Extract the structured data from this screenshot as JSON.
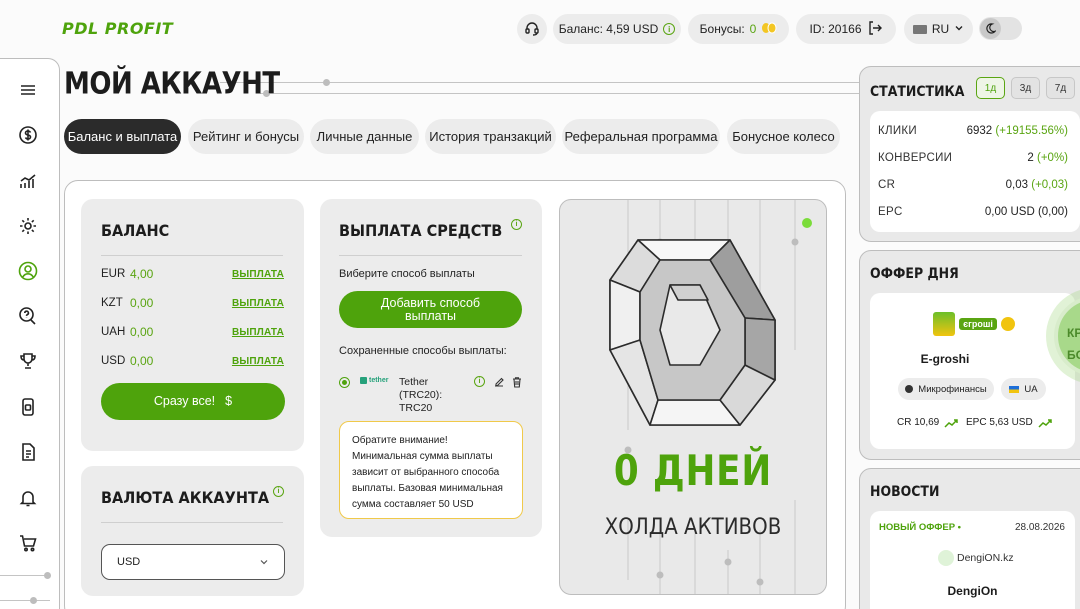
{
  "app": {
    "logo": "PDL PROFIT",
    "balance_label": "Баланс: 4,59 USD",
    "bonus_label": "Бонусы:",
    "bonus_value": "0",
    "id_label": "ID: 20166",
    "lang": "RU",
    "colors": {
      "accent": "#4ea30c",
      "dark": "#2b2b2b",
      "card": "#ececec",
      "notice_border": "#f0c94a"
    }
  },
  "page": {
    "title": "МОЙ АККАУНТ"
  },
  "tabs": [
    {
      "label": "Баланс и выплата",
      "active": true
    },
    {
      "label": "Рейтинг и бонусы"
    },
    {
      "label": "Личные данные"
    },
    {
      "label": "История транзакций"
    },
    {
      "label": "Реферальная программа"
    },
    {
      "label": "Бонусное колесо"
    }
  ],
  "balance": {
    "title": "БАЛАНС",
    "rows": [
      {
        "currency": "EUR",
        "amount": "4,00",
        "link": "ВЫПЛАТА"
      },
      {
        "currency": "KZT",
        "amount": "0,00",
        "link": "ВЫПЛАТА"
      },
      {
        "currency": "UAH",
        "amount": "0,00",
        "link": "ВЫПЛАТА"
      },
      {
        "currency": "USD",
        "amount": "0,00",
        "link": "ВЫПЛАТА"
      }
    ],
    "all_button": "Сразу все!",
    "all_button_icon": "$"
  },
  "currency": {
    "title": "ВАЛЮТА АККАУНТА",
    "selected": "USD"
  },
  "payout": {
    "title": "ВЫПЛАТА СРЕДСТВ",
    "choose_label": "Виберите способ выплаты",
    "add_button": "Добавить способ выплаты",
    "saved_label": "Сохраненные способы выплаты:",
    "method_logo": "tether",
    "method_name": "Tether (TRC20): TRC20",
    "notice": "Обратите внимание! Минимальная сумма выплаты зависит от выбранного способа выплаты. Базовая минимальная сумма составляет 50 USD"
  },
  "promo": {
    "big": "0 ДНЕЙ",
    "sub": "ХОЛДА АКТИВОВ",
    "glyph": "0"
  },
  "stats": {
    "title": "СТАТИСТИКА",
    "periods": [
      "1д",
      "3д",
      "7д"
    ],
    "rows": [
      {
        "label": "КЛИКИ",
        "value": "6932",
        "delta": "(+19155.56%)"
      },
      {
        "label": "КОНВЕРСИИ",
        "value": "2",
        "delta": "(+0%)"
      },
      {
        "label": "CR",
        "value": "0,03",
        "delta": "(+0,03)"
      },
      {
        "label": "EPC",
        "value": "0,00 USD",
        "delta": "(0,00)"
      }
    ]
  },
  "offer": {
    "title": "ОФФЕР ДНЯ",
    "logo_text": "єгрошi",
    "name": "E-groshi",
    "category": "Микрофинансы",
    "country": "UA",
    "cr": "CR  10,69",
    "epc": "EPC  5,63 USD",
    "badge_top": "КР",
    "badge_bottom": "БО"
  },
  "news": {
    "title": "НОВОСТИ",
    "tag": "НОВЫЙ ОФФЕР •",
    "date": "28.08.2026",
    "logo_text": "DengiON.kz",
    "name": "DengiOn"
  }
}
